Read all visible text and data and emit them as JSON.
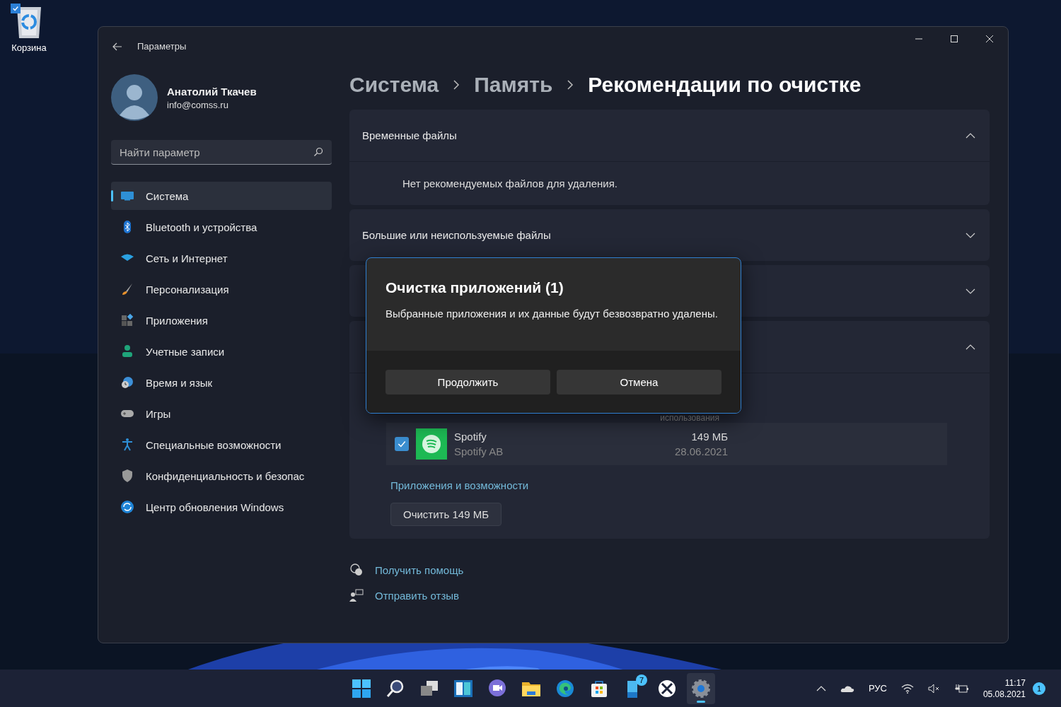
{
  "desktop": {
    "icons": [
      {
        "label": "Корзина",
        "selected": true
      }
    ]
  },
  "window": {
    "title": "Параметры"
  },
  "user": {
    "name": "Анатолий Ткачев",
    "email": "info@comss.ru"
  },
  "search": {
    "placeholder": "Найти параметр"
  },
  "sidebar": {
    "items": [
      {
        "label": "Система",
        "kind": "system",
        "selected": true
      },
      {
        "label": "Bluetooth и устройства",
        "kind": "bluetooth",
        "selected": false
      },
      {
        "label": "Сеть и Интернет",
        "kind": "network",
        "selected": false
      },
      {
        "label": "Персонализация",
        "kind": "brush",
        "selected": false
      },
      {
        "label": "Приложения",
        "kind": "apps",
        "selected": false
      },
      {
        "label": "Учетные записи",
        "kind": "account",
        "selected": false
      },
      {
        "label": "Время и язык",
        "kind": "time",
        "selected": false
      },
      {
        "label": "Игры",
        "kind": "games",
        "selected": false
      },
      {
        "label": "Специальные возможности",
        "kind": "accessibility",
        "selected": false
      },
      {
        "label": "Конфиденциальность и безопас",
        "kind": "privacy",
        "selected": false
      },
      {
        "label": "Центр обновления Windows",
        "kind": "update",
        "selected": false
      }
    ]
  },
  "breadcrumb": [
    "Система",
    "Память",
    "Рекомендации по очистке"
  ],
  "sections": [
    {
      "title": "Временные файлы",
      "expanded": true,
      "message": "Нет рекомендуемых файлов для удаления."
    },
    {
      "title": "Большие или неиспользуемые файлы",
      "expanded": false
    },
    {
      "expanded": false
    },
    {
      "expanded": true,
      "column_header": "использования",
      "apps": [
        {
          "name": "Spotify",
          "publisher": "Spotify AB",
          "size": "149 МБ",
          "date": "28.06.2021",
          "checked": true
        }
      ],
      "link": "Приложения и возможности",
      "button": "Очистить 149 МБ"
    }
  ],
  "help_links": [
    {
      "kind": "help",
      "label": "Получить помощь"
    },
    {
      "kind": "feedback",
      "label": "Отправить отзыв"
    }
  ],
  "dialog": {
    "title": "Очистка приложений (1)",
    "message": "Выбранные приложения и их данные будут безвозвратно удалены.",
    "buttons": [
      "Продолжить",
      "Отмена"
    ]
  },
  "taskbar": {
    "apps": [
      {
        "kind": "start",
        "selected": false
      },
      {
        "kind": "search",
        "selected": false
      },
      {
        "kind": "taskview",
        "selected": false
      },
      {
        "kind": "widgets",
        "selected": false
      },
      {
        "kind": "chat",
        "selected": false
      },
      {
        "kind": "explorer",
        "selected": false
      },
      {
        "kind": "edge",
        "selected": false
      },
      {
        "kind": "store",
        "selected": false
      },
      {
        "kind": "phone",
        "selected": false,
        "badge": "7"
      },
      {
        "kind": "xbox",
        "selected": false
      },
      {
        "kind": "settings",
        "selected": true
      }
    ]
  },
  "tray": {
    "language": "РУС",
    "time": "11:17",
    "date": "05.08.2021",
    "notifications": "1"
  }
}
